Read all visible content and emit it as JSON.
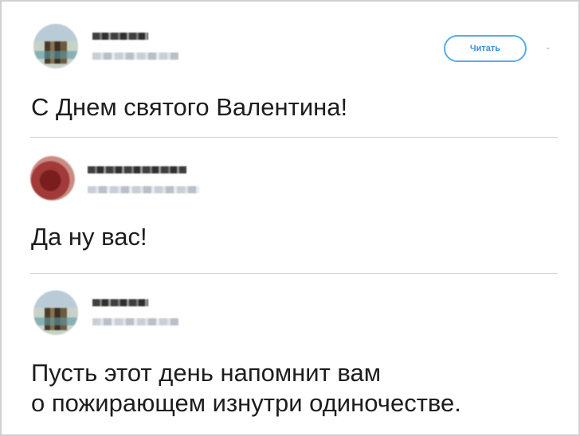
{
  "tweets": [
    {
      "text": "С Днем святого Валентина!",
      "follow_label": "Читать",
      "menu_icon": "chevron-down-icon"
    },
    {
      "text": "Да ну вас!"
    },
    {
      "text": "Пусть этот день напомнит вам\nо пожирающем изнутри одиночестве."
    }
  ],
  "colors": {
    "accent": "#55acee",
    "text": "#1d1d1d",
    "divider": "#cfcfcf"
  }
}
